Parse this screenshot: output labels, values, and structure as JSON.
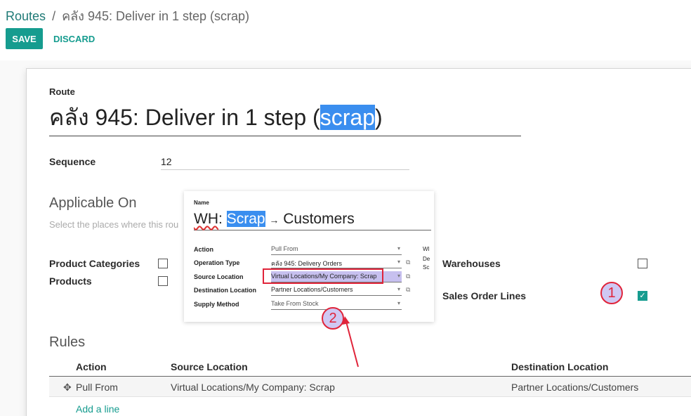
{
  "breadcrumb": {
    "parent": "Routes",
    "separator": "/",
    "current": "คลัง 945: Deliver in 1 step (scrap)"
  },
  "toolbar": {
    "save_label": "SAVE",
    "discard_label": "DISCARD"
  },
  "route": {
    "label": "Route",
    "title_prefix": "คลัง 945: Deliver in 1 step (",
    "title_highlight": "scrap",
    "title_suffix": ")"
  },
  "sequence": {
    "label": "Sequence",
    "value": "12"
  },
  "applicable_on": {
    "title": "Applicable On",
    "help": "Select the places where this rou",
    "product_categories": {
      "label": "Product Categories",
      "checked": false
    },
    "products": {
      "label": "Products",
      "checked": false
    },
    "warehouses": {
      "label": "Warehouses",
      "checked": false
    },
    "sales_order_lines": {
      "label": "Sales Order Lines",
      "checked": true
    }
  },
  "markers": {
    "one": "1",
    "two": "2"
  },
  "rules": {
    "title": "Rules",
    "columns": [
      "Action",
      "Source Location",
      "Destination Location"
    ],
    "rows": [
      {
        "action": "Pull From",
        "source": "Virtual Locations/My Company: Scrap",
        "destination": "Partner Locations/Customers"
      }
    ],
    "add_line": "Add a line"
  },
  "overlay": {
    "name_label": "Name",
    "name_part1": "WH",
    "name_part2": ":",
    "name_highlight": "Scrap",
    "name_arrow": "→",
    "name_part3": "Customers",
    "fields": [
      {
        "label": "Action",
        "value": "Pull From"
      },
      {
        "label": "Operation Type",
        "value": "คลัง 945: Delivery Orders"
      },
      {
        "label": "Source Location",
        "value": "Virtual Locations/My Company: Scrap"
      },
      {
        "label": "Destination Location",
        "value": "Partner Locations/Customers"
      },
      {
        "label": "Supply Method",
        "value": "Take From Stock"
      }
    ],
    "side_labels": [
      "Wl",
      "De",
      "Sc"
    ]
  },
  "colors": {
    "accent": "#169c8f",
    "highlight": "#3a8eef",
    "annotation": "#e0243a"
  },
  "icons": {
    "checkbox_checked": "check-icon",
    "drag_handle": "move-icon",
    "dropdown": "caret-down-icon",
    "external_link": "external-link-icon"
  }
}
